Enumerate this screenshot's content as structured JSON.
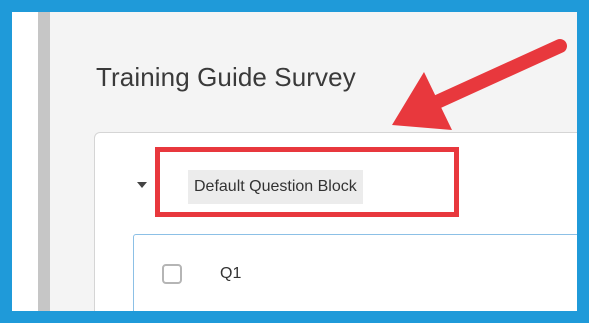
{
  "survey": {
    "title": "Training Guide Survey"
  },
  "block": {
    "name": "Default Question Block",
    "collapse_icon": "caret-down-icon"
  },
  "question": {
    "label": "Q1",
    "selected": false
  },
  "annotation": {
    "color": "#e8383d",
    "frame_color": "#1f9ad9"
  }
}
